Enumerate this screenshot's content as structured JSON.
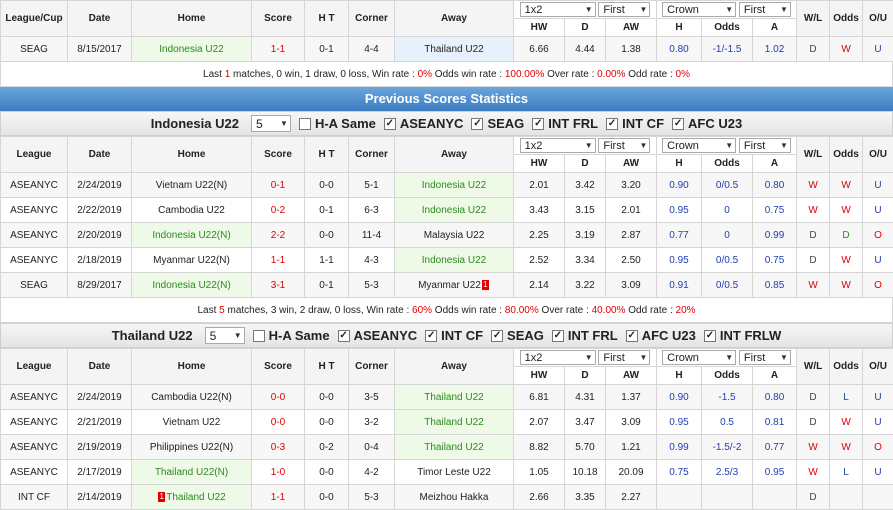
{
  "h2h": {
    "headers": {
      "league": "League/Cup",
      "date": "Date",
      "home": "Home",
      "score": "Score",
      "ht": "H T",
      "corner": "Corner",
      "away": "Away",
      "hw": "HW",
      "d": "D",
      "aw": "AW",
      "h": "H",
      "odds": "Odds",
      "a": "A",
      "wl": "W/L",
      "odds2": "Odds",
      "ou": "O/U"
    },
    "selects": {
      "type": "1x2",
      "first1": "First",
      "company": "Crown",
      "first2": "First"
    },
    "rows": [
      {
        "league": "SEAG",
        "date": "8/15/2017",
        "home": "Indonesia U22",
        "score": "1-1",
        "ht": "0-1",
        "corner": "4-4",
        "away": "Thailand U22",
        "hw": "6.66",
        "d": "4.44",
        "aw": "1.38",
        "h": "0.80",
        "odds": "-1/-1.5",
        "a": "1.02",
        "wl": "D",
        "odds2": "W",
        "ou": "U"
      }
    ],
    "summary": {
      "pre": "Last ",
      "n": "1",
      "mid": " matches, 0 win, 1 draw, 0 loss, Win rate : ",
      "win": "0%",
      "mid2": " Odds win rate : ",
      "odds": "100.00%",
      "mid3": " Over rate : ",
      "over": "0.00%",
      "mid4": " Odd rate : ",
      "odd": "0%"
    }
  },
  "banner": "Previous Scores Statistics",
  "indonesia": {
    "team": "Indonesia U22",
    "count": "5",
    "filters": [
      {
        "label": "H-A Same",
        "checked": false
      },
      {
        "label": "ASEANYC",
        "checked": true
      },
      {
        "label": "SEAG",
        "checked": true
      },
      {
        "label": "INT FRL",
        "checked": true
      },
      {
        "label": "INT CF",
        "checked": true
      },
      {
        "label": "AFC U23",
        "checked": true
      }
    ],
    "headers": {
      "league": "League",
      "date": "Date",
      "home": "Home",
      "score": "Score",
      "ht": "H T",
      "corner": "Corner",
      "away": "Away",
      "hw": "HW",
      "d": "D",
      "aw": "AW",
      "h": "H",
      "odds": "Odds",
      "a": "A",
      "wl": "W/L",
      "odds2": "Odds",
      "ou": "O/U"
    },
    "selects": {
      "type": "1x2",
      "first1": "First",
      "company": "Crown",
      "first2": "First"
    },
    "rows": [
      {
        "league": "ASEANYC",
        "date": "2/24/2019",
        "home": "Vietnam U22(N)",
        "score": "0-1",
        "ht": "0-0",
        "corner": "5-1",
        "away": "Indonesia U22",
        "hw": "2.01",
        "d": "3.42",
        "aw": "3.20",
        "h": "0.90",
        "odds": "0/0.5",
        "a": "0.80",
        "wl": "W",
        "odds2": "W",
        "ou": "U"
      },
      {
        "league": "ASEANYC",
        "date": "2/22/2019",
        "home": "Cambodia U22",
        "score": "0-2",
        "ht": "0-1",
        "corner": "6-3",
        "away": "Indonesia U22",
        "hw": "3.43",
        "d": "3.15",
        "aw": "2.01",
        "h": "0.95",
        "odds": "0",
        "a": "0.75",
        "wl": "W",
        "odds2": "W",
        "ou": "U"
      },
      {
        "league": "ASEANYC",
        "date": "2/20/2019",
        "home": "Indonesia U22(N)",
        "score": "2-2",
        "ht": "0-0",
        "corner": "11-4",
        "away": "Malaysia U22",
        "hw": "2.25",
        "d": "3.19",
        "aw": "2.87",
        "h": "0.77",
        "odds": "0",
        "a": "0.99",
        "wl": "D",
        "odds2": "D",
        "ou": "O"
      },
      {
        "league": "ASEANYC",
        "date": "2/18/2019",
        "home": "Myanmar U22(N)",
        "score": "1-1",
        "ht": "1-1",
        "corner": "4-3",
        "away": "Indonesia U22",
        "hw": "2.52",
        "d": "3.34",
        "aw": "2.50",
        "h": "0.95",
        "odds": "0/0.5",
        "a": "0.75",
        "wl": "D",
        "odds2": "W",
        "ou": "U"
      },
      {
        "league": "SEAG",
        "date": "8/29/2017",
        "home": "Indonesia U22(N)",
        "score": "3-1",
        "ht": "0-1",
        "corner": "5-3",
        "away": "Myanmar U22",
        "away_flag": "1",
        "hw": "2.14",
        "d": "3.22",
        "aw": "3.09",
        "h": "0.91",
        "odds": "0/0.5",
        "a": "0.85",
        "wl": "W",
        "odds2": "W",
        "ou": "O"
      }
    ],
    "summary": {
      "pre": "Last ",
      "n": "5",
      "mid": " matches, 3 win, 2 draw, 0 loss, Win rate : ",
      "win": "60%",
      "mid2": " Odds win rate : ",
      "odds": "80.00%",
      "mid3": " Over rate : ",
      "over": "40.00%",
      "mid4": " Odd rate : ",
      "odd": "20%"
    }
  },
  "thailand": {
    "team": "Thailand U22",
    "count": "5",
    "filters": [
      {
        "label": "H-A Same",
        "checked": false
      },
      {
        "label": "ASEANYC",
        "checked": true
      },
      {
        "label": "INT CF",
        "checked": true
      },
      {
        "label": "SEAG",
        "checked": true
      },
      {
        "label": "INT FRL",
        "checked": true
      },
      {
        "label": "AFC U23",
        "checked": true
      },
      {
        "label": "INT FRLW",
        "checked": true
      }
    ],
    "headers": {
      "league": "League",
      "date": "Date",
      "home": "Home",
      "score": "Score",
      "ht": "H T",
      "corner": "Corner",
      "away": "Away",
      "hw": "HW",
      "d": "D",
      "aw": "AW",
      "h": "H",
      "odds": "Odds",
      "a": "A",
      "wl": "W/L",
      "odds2": "Odds",
      "ou": "O/U"
    },
    "selects": {
      "type": "1x2",
      "first1": "First",
      "company": "Crown",
      "first2": "First"
    },
    "rows": [
      {
        "league": "ASEANYC",
        "date": "2/24/2019",
        "home": "Cambodia U22(N)",
        "score": "0-0",
        "ht": "0-0",
        "corner": "3-5",
        "away": "Thailand U22",
        "hw": "6.81",
        "d": "4.31",
        "aw": "1.37",
        "h": "0.90",
        "odds": "-1.5",
        "a": "0.80",
        "wl": "D",
        "odds2": "L",
        "ou": "U"
      },
      {
        "league": "ASEANYC",
        "date": "2/21/2019",
        "home": "Vietnam U22",
        "score": "0-0",
        "ht": "0-0",
        "corner": "3-2",
        "away": "Thailand U22",
        "hw": "2.07",
        "d": "3.47",
        "aw": "3.09",
        "h": "0.95",
        "odds": "0.5",
        "a": "0.81",
        "wl": "D",
        "odds2": "W",
        "ou": "U"
      },
      {
        "league": "ASEANYC",
        "date": "2/19/2019",
        "home": "Philippines U22(N)",
        "score": "0-3",
        "ht": "0-2",
        "corner": "0-4",
        "away": "Thailand U22",
        "hw": "8.82",
        "d": "5.70",
        "aw": "1.21",
        "h": "0.99",
        "odds": "-1.5/-2",
        "a": "0.77",
        "wl": "W",
        "odds2": "W",
        "ou": "O"
      },
      {
        "league": "ASEANYC",
        "date": "2/17/2019",
        "home": "Thailand U22(N)",
        "score": "1-0",
        "ht": "0-0",
        "corner": "4-2",
        "away": "Timor Leste U22",
        "hw": "1.05",
        "d": "10.18",
        "aw": "20.09",
        "h": "0.75",
        "odds": "2.5/3",
        "a": "0.95",
        "wl": "W",
        "odds2": "L",
        "ou": "U"
      },
      {
        "league": "INT CF",
        "date": "2/14/2019",
        "home": "Thailand U22",
        "home_flag": "1",
        "score": "1-1",
        "ht": "0-0",
        "corner": "5-3",
        "away": "Meizhou Hakka",
        "hw": "2.66",
        "d": "3.35",
        "aw": "2.27",
        "h": "",
        "odds": "",
        "a": "",
        "wl": "D",
        "odds2": "",
        "ou": ""
      }
    ]
  }
}
